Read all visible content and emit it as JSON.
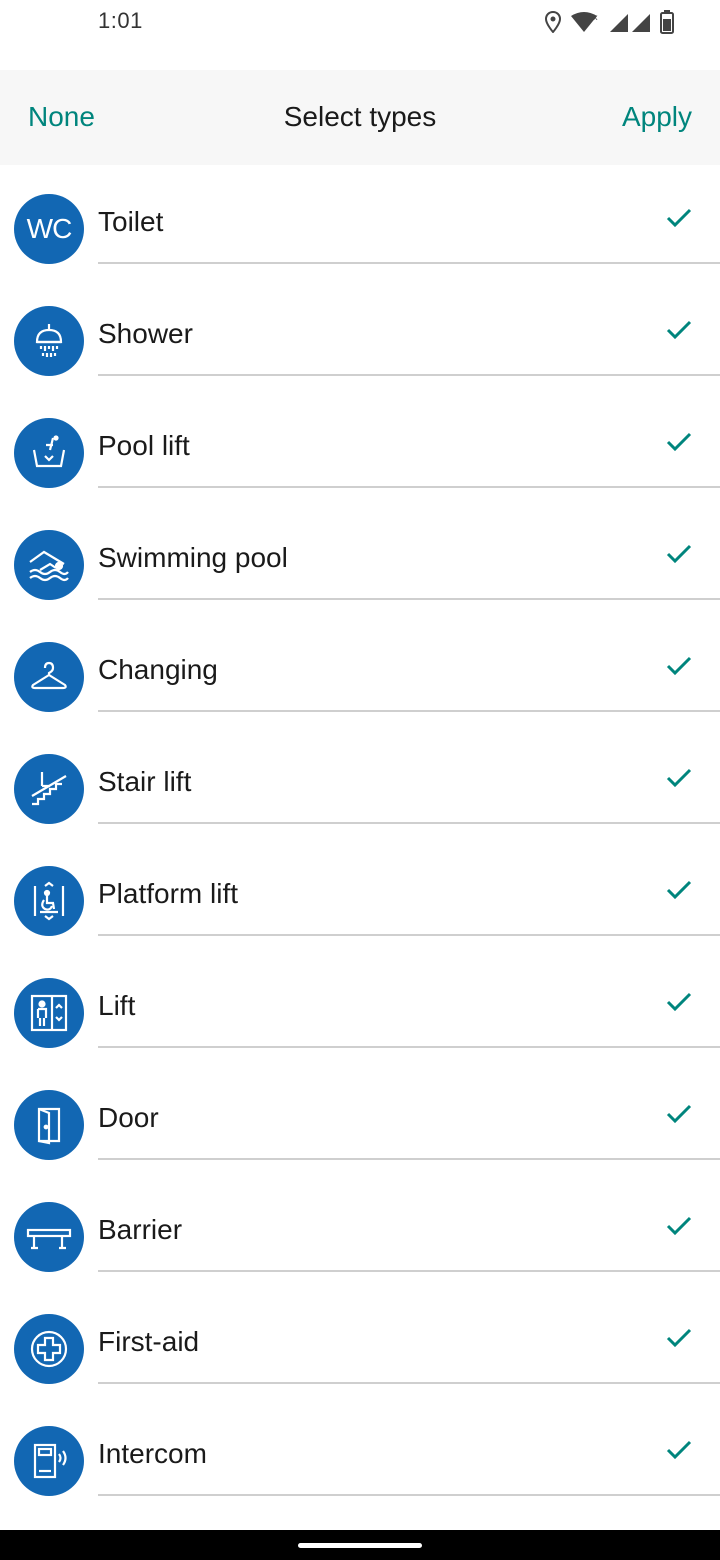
{
  "status_bar": {
    "time": "1:01",
    "icons": [
      "location-icon",
      "wifi-icon",
      "signal-icon",
      "battery-icon"
    ]
  },
  "toolbar": {
    "none_label": "None",
    "title": "Select types",
    "apply_label": "Apply"
  },
  "colors": {
    "accent": "#00857d",
    "icon_circle": "#1267b3",
    "divider": "#cfcfcf"
  },
  "items": [
    {
      "label": "Toilet",
      "icon": "wc-icon",
      "icon_text": "WC",
      "checked": true
    },
    {
      "label": "Shower",
      "icon": "shower-icon",
      "checked": true
    },
    {
      "label": "Pool lift",
      "icon": "pool-lift-icon",
      "checked": true
    },
    {
      "label": "Swimming pool",
      "icon": "swimming-pool-icon",
      "checked": true
    },
    {
      "label": "Changing",
      "icon": "hanger-icon",
      "checked": true
    },
    {
      "label": "Stair lift",
      "icon": "stair-lift-icon",
      "checked": true
    },
    {
      "label": "Platform lift",
      "icon": "platform-lift-icon",
      "checked": true
    },
    {
      "label": "Lift",
      "icon": "lift-icon",
      "checked": true
    },
    {
      "label": "Door",
      "icon": "door-icon",
      "checked": true
    },
    {
      "label": "Barrier",
      "icon": "barrier-icon",
      "checked": true
    },
    {
      "label": "First-aid",
      "icon": "first-aid-icon",
      "checked": true
    },
    {
      "label": "Intercom",
      "icon": "intercom-icon",
      "checked": true
    }
  ]
}
